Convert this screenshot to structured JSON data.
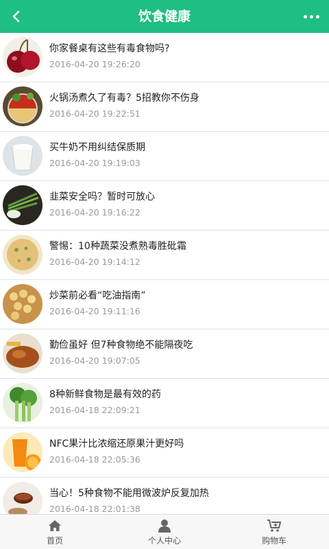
{
  "header": {
    "title": "饮食健康",
    "back_icon": "chevron-left-icon",
    "more_icon": "more-dots-icon"
  },
  "colors": {
    "brand": "#1fbe82"
  },
  "articles": [
    {
      "title": "你家餐桌有这些有毒食物吗?",
      "date": "2016-04-20 19:26:20",
      "icon": "cherry-thumbnail"
    },
    {
      "title": "火锅汤煮久了有毒？5招教你不伤身",
      "date": "2016-04-20 19:22:51",
      "icon": "hotpot-thumbnail"
    },
    {
      "title": "买牛奶不用纠结保质期",
      "date": "2016-04-20 19:19:03",
      "icon": "milk-thumbnail"
    },
    {
      "title": "韭菜安全吗？暂时可放心",
      "date": "2016-04-20 19:16:22",
      "icon": "chive-thumbnail"
    },
    {
      "title": "警惕：10种蔬菜没煮熟毒胜砒霜",
      "date": "2016-04-20 19:14:12",
      "icon": "pancake-thumbnail"
    },
    {
      "title": "炒菜前必看“吃油指南”",
      "date": "2016-04-20 19:11:16",
      "icon": "soybean-thumbnail"
    },
    {
      "title": "勤俭虽好 但7种食物绝不能隔夜吃",
      "date": "2016-04-20 19:07:05",
      "icon": "roast-chicken-thumbnail"
    },
    {
      "title": "8种新鲜食物是最有效的药",
      "date": "2016-04-18 22:09:21",
      "icon": "celery-thumbnail"
    },
    {
      "title": "NFC果汁比浓缩还原果汁更好吗",
      "date": "2016-04-18 22:05:36",
      "icon": "juice-thumbnail"
    },
    {
      "title": "当心！5种食物不能用微波炉反复加热",
      "date": "2016-04-18 22:01:38",
      "icon": "tea-thumbnail"
    }
  ],
  "tabbar": {
    "home": {
      "label": "首页",
      "icon": "home-icon"
    },
    "user": {
      "label": "个人中心",
      "icon": "user-icon"
    },
    "cart": {
      "label": "购物车",
      "icon": "cart-icon"
    }
  }
}
